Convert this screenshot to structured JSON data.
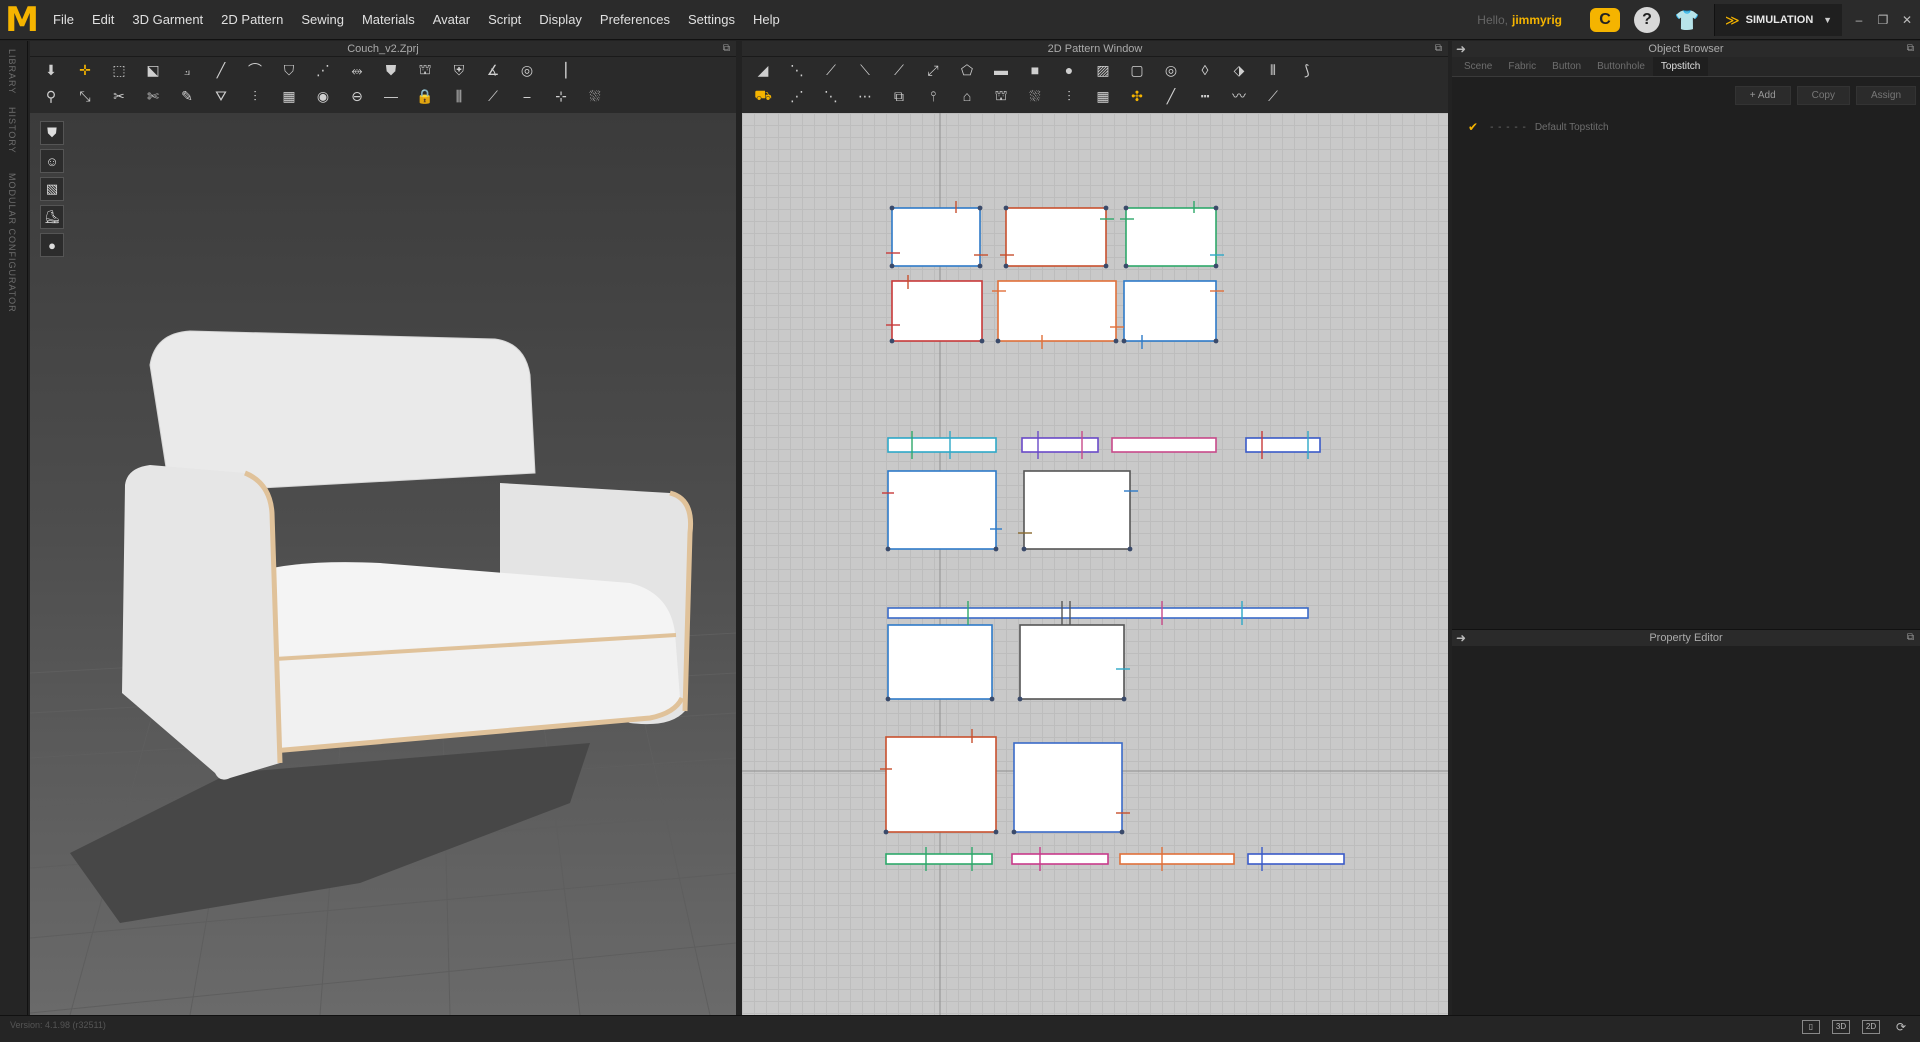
{
  "app": {
    "logo": "M"
  },
  "menu": [
    "File",
    "Edit",
    "3D Garment",
    "2D Pattern",
    "Sewing",
    "Materials",
    "Avatar",
    "Script",
    "Display",
    "Preferences",
    "Settings",
    "Help"
  ],
  "user": {
    "greeting": "Hello,",
    "name": "jimmyrig"
  },
  "mode": {
    "label": "SIMULATION"
  },
  "window_controls": [
    "–",
    "❐",
    "✕"
  ],
  "left_dock": [
    "LIBRARY",
    "HISTORY",
    "MODULAR CONFIGURATOR"
  ],
  "panels": {
    "view3d_title": "Couch_v2.Zprj",
    "view2d_title": "2D Pattern Window",
    "object_browser_title": "Object Browser",
    "property_editor_title": "Property Editor"
  },
  "object_browser": {
    "tabs": [
      "Scene",
      "Fabric",
      "Button",
      "Buttonhole",
      "Topstitch"
    ],
    "active_tab": "Topstitch",
    "actions": [
      "+ Add",
      "Copy",
      "Assign"
    ],
    "items": [
      {
        "name": "Default Topstitch"
      }
    ]
  },
  "status": {
    "version": "Version: 4.1.98 (r32511)",
    "view_modes": [
      "▯",
      "3D",
      "2D",
      "⟳"
    ]
  },
  "colors": {
    "accent": "#f5b400",
    "panel_bg": "#1f1f1f",
    "canvas_2d": "#c9c9c9"
  }
}
